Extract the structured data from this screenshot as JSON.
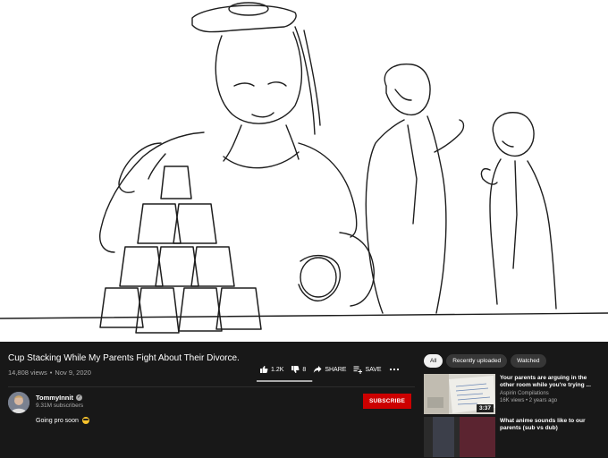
{
  "video": {
    "title": "Cup Stacking While My Parents Fight About Their Divorce.",
    "views": "14,808 views",
    "date": "Nov 9, 2020",
    "like_count": "1.2K",
    "dislike_count": "8",
    "share_label": "SHARE",
    "save_label": "SAVE",
    "like_ratio": 0.99
  },
  "channel": {
    "name": "TommyInnit",
    "subscribers": "9.31M subscribers",
    "subscribe_label": "SUBSCRIBE",
    "description": "Going pro soon"
  },
  "chips": [
    "All",
    "Recently uploaded",
    "Watched"
  ],
  "recommendations": [
    {
      "title": "Your parents are arguing in the other room while you're trying ...",
      "channel": "Aspirin Compilations",
      "meta": "16K views • 2 years ago",
      "duration": "3:37"
    },
    {
      "title": "What anime sounds like to our parents (sub vs dub)"
    }
  ],
  "colors": {
    "background": "#181818",
    "subscribe": "#cc0000",
    "muted_text": "#aaaaaa"
  }
}
